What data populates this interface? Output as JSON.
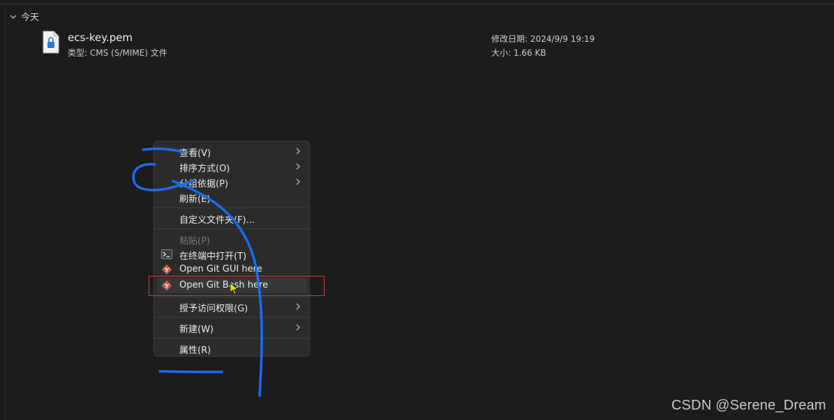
{
  "group": {
    "title": "今天"
  },
  "file": {
    "name": "ecs-key.pem",
    "type": "类型: CMS (S/MIME) 文件",
    "modified": "修改日期: 2024/9/9 19:19",
    "size": "大小: 1.66 KB"
  },
  "context_menu": {
    "items": [
      {
        "label": "查看(V)",
        "submenu": true
      },
      {
        "label": "排序方式(O)",
        "submenu": true
      },
      {
        "label": "分组依据(P)",
        "submenu": true
      },
      {
        "label": "刷新(E)"
      },
      {
        "label": "自定义文件夹(F)..."
      },
      {
        "label": "粘贴(P)",
        "disabled": true
      },
      {
        "label": "在终端中打开(T)",
        "icon": "terminal-icon"
      },
      {
        "label": "Open Git GUI here",
        "icon": "git-icon"
      },
      {
        "label": "Open Git Bash here",
        "icon": "git-icon",
        "highlighted": true
      },
      {
        "label": "授予访问权限(G)",
        "submenu": true
      },
      {
        "label": "新建(W)",
        "submenu": true
      },
      {
        "label": "属性(R)"
      }
    ]
  },
  "colors": {
    "background": "#1c1c1c",
    "menu_background": "#2b2b2b",
    "highlight_border": "#d93a3a",
    "annotation_stroke": "#1a6df0",
    "git_icon": "#e0533d"
  },
  "watermark": "CSDN @Serene_Dream"
}
